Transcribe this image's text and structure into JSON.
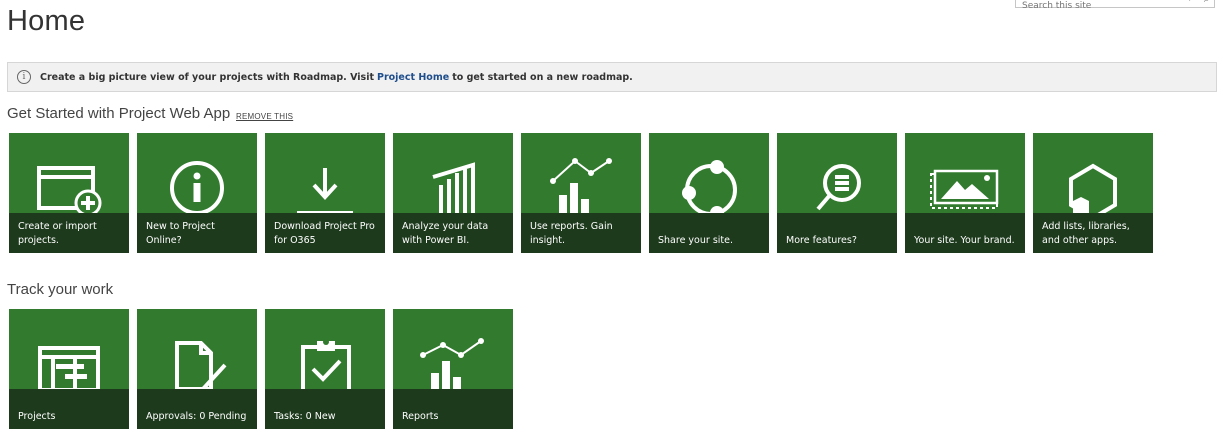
{
  "search": {
    "placeholder": "Search this site"
  },
  "page": {
    "title": "Home"
  },
  "banner": {
    "text_before": "Create a big picture view of your projects with Roadmap. Visit",
    "link_text": "Project Home",
    "text_after": "to get started on a new roadmap."
  },
  "get_started": {
    "title": "Get Started with Project Web App",
    "remove_label": "REMOVE THIS",
    "tiles": [
      {
        "label": "Create or import projects.",
        "icon": "window-add-icon"
      },
      {
        "label": "New to Project Online?",
        "icon": "info-icon"
      },
      {
        "label": "Download Project Pro for O365",
        "icon": "download-icon"
      },
      {
        "label": "Analyze your data with Power BI.",
        "icon": "power-bi-icon"
      },
      {
        "label": "Use reports. Gain insight.",
        "icon": "reports-chart-icon"
      },
      {
        "label": "Share your site.",
        "icon": "share-icon"
      },
      {
        "label": "More features?",
        "icon": "magnifier-list-icon"
      },
      {
        "label": "Your site. Your brand.",
        "icon": "landscape-image-icon"
      },
      {
        "label": "Add lists, libraries, and other apps.",
        "icon": "apps-hexagon-icon"
      }
    ]
  },
  "track": {
    "title": "Track your work",
    "tiles": [
      {
        "label": "Projects",
        "icon": "gantt-icon"
      },
      {
        "label": "Approvals: 0 Pending",
        "icon": "document-pencil-icon"
      },
      {
        "label": "Tasks: 0 New",
        "icon": "clipboard-check-icon"
      },
      {
        "label": "Reports",
        "icon": "reports-chart-icon"
      }
    ]
  },
  "colors": {
    "tile": "#317a2e",
    "caption": "#1d3a1c",
    "link": "#1f4e8c"
  }
}
